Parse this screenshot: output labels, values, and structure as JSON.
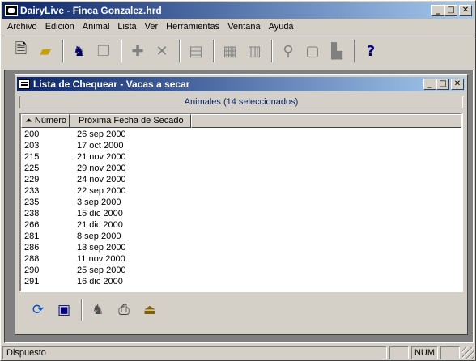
{
  "app": {
    "title": "DairyLive - Finca Gonzalez.hrd",
    "window_buttons": {
      "minimize": "_",
      "maximize": "□",
      "close": "✕"
    }
  },
  "menu": [
    "Archivo",
    "Edición",
    "Animal",
    "Lista",
    "Ver",
    "Herramientas",
    "Ventana",
    "Ayuda"
  ],
  "toolbar": {
    "icons": [
      "new-document-icon",
      "open-folder-icon",
      "cow-icon",
      "copy-icon",
      "add-icon",
      "delete-icon",
      "report-icon",
      "event-icon",
      "event-list-icon",
      "search-icon",
      "clipboard-icon",
      "chart-icon",
      "help-icon"
    ]
  },
  "child_window": {
    "title": "Lista de Chequear - Vacas a secar",
    "subheader": "Animales (14 seleccionados)",
    "columns": [
      "Número",
      "Próxima Fecha de Secado"
    ],
    "rows": [
      [
        "200",
        "26 sep 2000"
      ],
      [
        "203",
        "17 oct 2000"
      ],
      [
        "215",
        "21 nov 2000"
      ],
      [
        "225",
        "29 nov 2000"
      ],
      [
        "229",
        "24 nov 2000"
      ],
      [
        "233",
        "22 sep 2000"
      ],
      [
        "235",
        "3 sep 2000"
      ],
      [
        "238",
        "15 dic 2000"
      ],
      [
        "266",
        "21 dic 2000"
      ],
      [
        "281",
        "8 sep 2000"
      ],
      [
        "286",
        "13 sep 2000"
      ],
      [
        "288",
        "11 nov 2000"
      ],
      [
        "290",
        "25 sep 2000"
      ],
      [
        "291",
        "16 dic 2000"
      ]
    ],
    "bottom_icons": [
      "refresh-icon",
      "window-icon",
      "cow-icon",
      "print-icon",
      "export-icon"
    ]
  },
  "status": {
    "text": "Dispuesto",
    "num": "NUM"
  }
}
